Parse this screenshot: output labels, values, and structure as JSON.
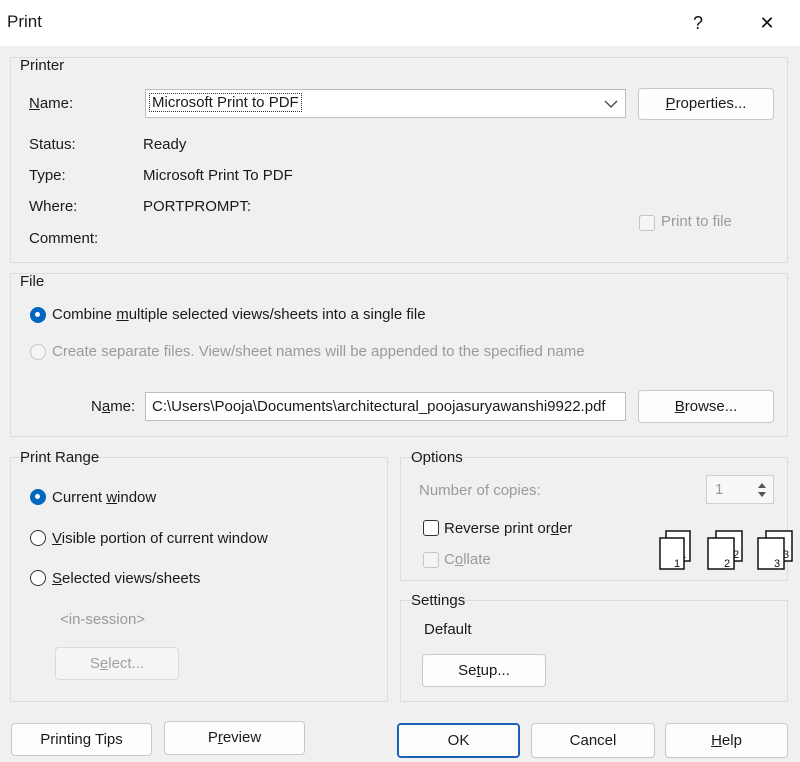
{
  "window": {
    "title": "Print",
    "help_glyph": "?",
    "close_glyph": "✕"
  },
  "printer": {
    "group_label": "Printer",
    "name_label": "Name:",
    "name_value": "Microsoft Print to PDF",
    "properties_button": "Properties...",
    "status_label": "Status:",
    "status_value": "Ready",
    "type_label": "Type:",
    "type_value": "Microsoft Print To PDF",
    "where_label": "Where:",
    "where_value": "PORTPROMPT:",
    "comment_label": "Comment:",
    "print_to_file_label": "Print to file"
  },
  "file": {
    "group_label": "File",
    "combine_label": "Combine multiple selected views/sheets into a single file",
    "separate_label": "Create separate files. View/sheet names will be appended to the specified name",
    "name_label": "Name:",
    "name_value": "C:\\Users\\Pooja\\Documents\\architectural_poojasuryawanshi9922.pdf",
    "browse_button": "Browse..."
  },
  "print_range": {
    "group_label": "Print Range",
    "current_window": "Current window",
    "visible_portion": "Visible portion of current window",
    "selected_views": "Selected views/sheets",
    "in_session": "<in-session>",
    "select_button": "Select..."
  },
  "options": {
    "group_label": "Options",
    "copies_label": "Number of copies:",
    "copies_value": "1",
    "reverse_label": "Reverse print order",
    "collate_label": "Collate"
  },
  "settings": {
    "group_label": "Settings",
    "value": "Default",
    "setup_button": "Setup..."
  },
  "footer": {
    "tips_button": "Printing Tips",
    "preview_button": "Preview",
    "ok_button": "OK",
    "cancel_button": "Cancel",
    "help_button": "Help"
  },
  "colors": {
    "accent": "#0067c0",
    "background": "#f0f0f0"
  }
}
